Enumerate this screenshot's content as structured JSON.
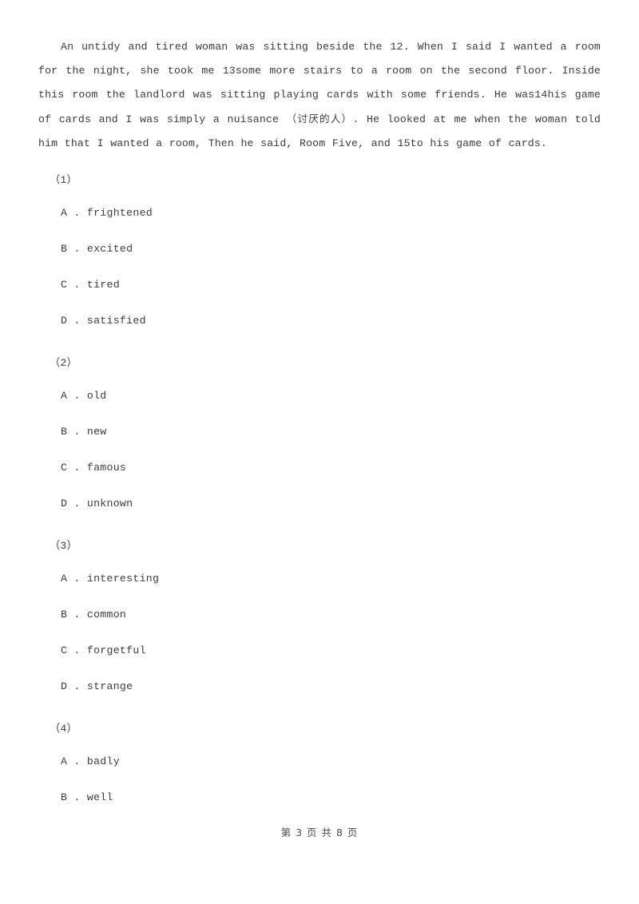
{
  "document": {
    "passage": {
      "segments": [
        {
          "type": "text",
          "value": "An untidy and tired woman was sitting beside the 12. When I said I wanted a room for the night, she took me 13some more stairs to a room on the second floor. Inside this room the landlord was sitting playing cards with some friends. He was14his game of cards and I was simply a nuisance "
        },
        {
          "type": "cjk",
          "value": "（讨厌的人）"
        },
        {
          "type": "text",
          "value": ". He looked at me when the woman told him that I wanted a room, Then he said, Room Five, and 15to his game of cards."
        }
      ],
      "full_text": "An untidy and tired woman was sitting beside the 12. When I said I wanted a room for the night, she took me 13some more stairs to a room on the second floor. Inside this room the landlord was sitting playing cards with some friends. He was14his game of cards and I was simply a nuisance （讨厌的人）. He looked at me when the woman told him that I wanted a room, Then he said, Room Five, and 15to his game of cards."
    },
    "questions": [
      {
        "number": "（1）",
        "options": [
          "A . frightened",
          "B . excited",
          "C . tired",
          "D . satisfied"
        ]
      },
      {
        "number": "（2）",
        "options": [
          "A . old",
          "B . new",
          "C . famous",
          "D . unknown"
        ]
      },
      {
        "number": "（3）",
        "options": [
          "A . interesting",
          "B . common",
          "C . forgetful",
          "D . strange"
        ]
      },
      {
        "number": "（4）",
        "options": [
          "A . badly",
          "B . well"
        ]
      }
    ],
    "footer": {
      "page_label": "第 3 页 共 8 页"
    }
  }
}
